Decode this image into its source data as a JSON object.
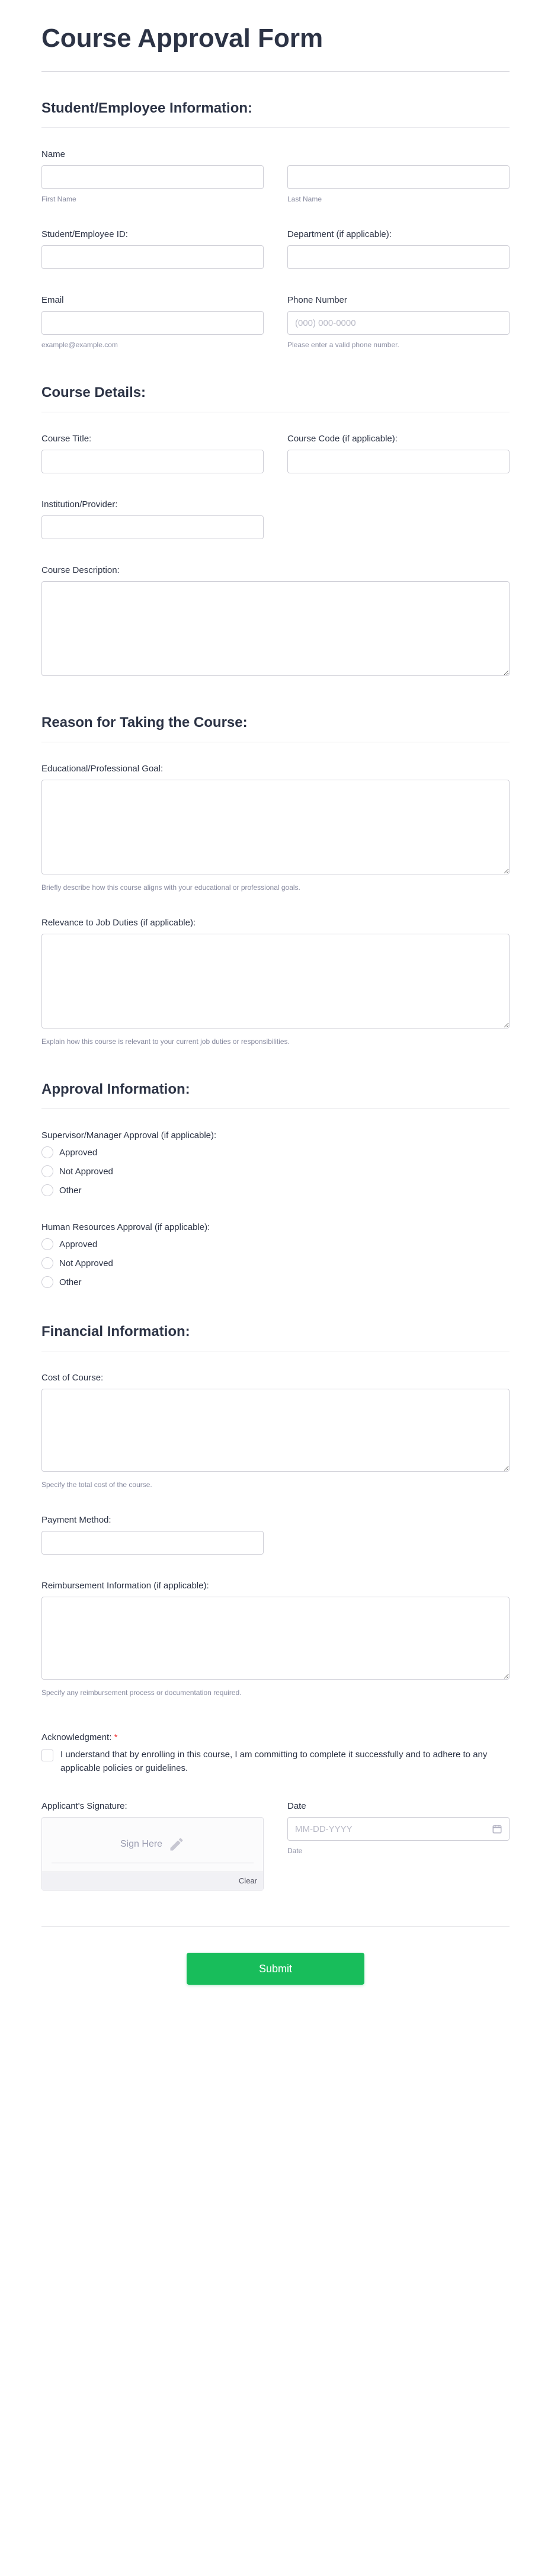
{
  "title": "Course Approval Form",
  "s1": {
    "heading": "Student/Employee Information:",
    "name_label": "Name",
    "first_sub": "First Name",
    "last_sub": "Last Name",
    "id_label": "Student/Employee ID:",
    "dept_label": "Department (if applicable):",
    "email_label": "Email",
    "email_sub": "example@example.com",
    "phone_label": "Phone Number",
    "phone_placeholder": "(000) 000-0000",
    "phone_sub": "Please enter a valid phone number."
  },
  "s2": {
    "heading": "Course Details:",
    "title_label": "Course Title:",
    "code_label": "Course Code (if applicable):",
    "inst_label": "Institution/Provider:",
    "desc_label": "Course Description:"
  },
  "s3": {
    "heading": "Reason for Taking the Course:",
    "goal_label": "Educational/Professional Goal:",
    "goal_sub": "Briefly describe how this course aligns with your educational or professional goals.",
    "rel_label": "Relevance to Job Duties (if applicable):",
    "rel_sub": "Explain how this course is relevant to your current job duties or responsibilities."
  },
  "s4": {
    "heading": "Approval Information:",
    "sup_label": "Supervisor/Manager Approval (if applicable):",
    "hr_label": "Human Resources Approval (if applicable):",
    "opt_approved": "Approved",
    "opt_not": "Not Approved",
    "opt_other": "Other"
  },
  "s5": {
    "heading": "Financial Information:",
    "cost_label": "Cost of Course:",
    "cost_sub": "Specify the total cost of the course.",
    "pay_label": "Payment Method:",
    "reimb_label": "Reimbursement Information (if applicable):",
    "reimb_sub": "Specify any reimbursement process or documentation required."
  },
  "s6": {
    "ack_label": "Acknowledgment:",
    "ack_text": "I understand that by enrolling in this course, I am committing to complete it successfully and to adhere to any applicable policies or guidelines.",
    "sig_label": "Applicant's Signature:",
    "sign_here": "Sign Here",
    "clear": "Clear",
    "date_label": "Date",
    "date_placeholder": "MM-DD-YYYY",
    "date_sub": "Date"
  },
  "submit": "Submit"
}
